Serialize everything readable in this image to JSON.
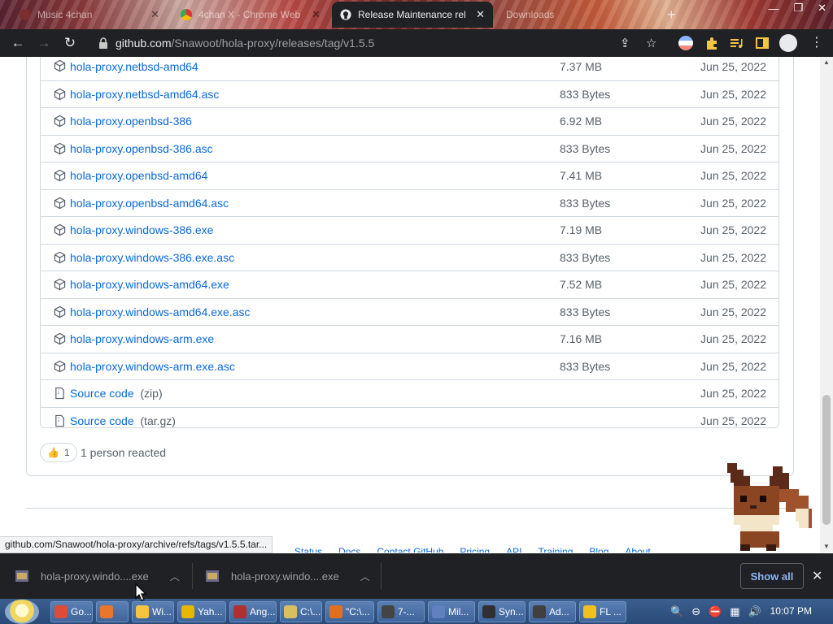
{
  "browser": {
    "tabs": [
      {
        "title": "Music 4chan",
        "active": false
      },
      {
        "title": "4chan X - Chrome Web",
        "active": false
      },
      {
        "title": "Release Maintenance rel",
        "active": true
      },
      {
        "title": "Downloads",
        "active": false
      }
    ],
    "url_host": "github.com",
    "url_path": "/Snawoot/hola-proxy/releases/tag/v1.5.5"
  },
  "assets": [
    {
      "name": "hola-proxy.netbsd-amd64",
      "size": "7.37 MB",
      "date": "Jun 25, 2022"
    },
    {
      "name": "hola-proxy.netbsd-amd64.asc",
      "size": "833 Bytes",
      "date": "Jun 25, 2022"
    },
    {
      "name": "hola-proxy.openbsd-386",
      "size": "6.92 MB",
      "date": "Jun 25, 2022"
    },
    {
      "name": "hola-proxy.openbsd-386.asc",
      "size": "833 Bytes",
      "date": "Jun 25, 2022"
    },
    {
      "name": "hola-proxy.openbsd-amd64",
      "size": "7.41 MB",
      "date": "Jun 25, 2022"
    },
    {
      "name": "hola-proxy.openbsd-amd64.asc",
      "size": "833 Bytes",
      "date": "Jun 25, 2022"
    },
    {
      "name": "hola-proxy.windows-386.exe",
      "size": "7.19 MB",
      "date": "Jun 25, 2022"
    },
    {
      "name": "hola-proxy.windows-386.exe.asc",
      "size": "833 Bytes",
      "date": "Jun 25, 2022"
    },
    {
      "name": "hola-proxy.windows-amd64.exe",
      "size": "7.52 MB",
      "date": "Jun 25, 2022"
    },
    {
      "name": "hola-proxy.windows-amd64.exe.asc",
      "size": "833 Bytes",
      "date": "Jun 25, 2022"
    },
    {
      "name": "hola-proxy.windows-arm.exe",
      "size": "7.16 MB",
      "date": "Jun 25, 2022"
    },
    {
      "name": "hola-proxy.windows-arm.exe.asc",
      "size": "833 Bytes",
      "date": "Jun 25, 2022"
    }
  ],
  "source_code": [
    {
      "label": "Source code",
      "format": "(zip)",
      "date": "Jun 25, 2022"
    },
    {
      "label": "Source code",
      "format": "(tar.gz)",
      "date": "Jun 25, 2022"
    }
  ],
  "reactions": {
    "emoji": "👍",
    "count": "1",
    "text": "1 person reacted"
  },
  "footer_links": [
    "Status",
    "Docs",
    "Contact GitHub",
    "Pricing",
    "API",
    "Training",
    "Blog",
    "About"
  ],
  "status_url": "github.com/Snawoot/hola-proxy/archive/refs/tags/v1.5.5.tar...",
  "downloads": {
    "items": [
      {
        "name": "hola-proxy.windo....exe"
      },
      {
        "name": "hola-proxy.windo....exe"
      }
    ],
    "show_all": "Show all"
  },
  "taskbar": {
    "items": [
      "Go...",
      "",
      "Wi...",
      "Yah...",
      "Ang...",
      "C:\\...",
      "\"C:\\...",
      "7-...",
      "Mil...",
      "Syn...",
      "Ad...",
      "FL ..."
    ],
    "clock": "10:07 PM"
  },
  "colors": {
    "link": "#0969da",
    "muted": "#57606a",
    "border": "#d0d7de",
    "chrome_dark": "#202124",
    "show_all": "#8ab4f8"
  },
  "icons": {
    "asset": "package-icon",
    "source": "file-zip-icon",
    "back": "back-arrow-icon",
    "forward": "forward-arrow-icon",
    "reload": "reload-icon",
    "lock": "lock-icon",
    "share": "share-icon",
    "star": "star-icon",
    "extensions": "puzzle-icon",
    "profile": "avatar-icon",
    "menu": "kebab-menu-icon"
  }
}
